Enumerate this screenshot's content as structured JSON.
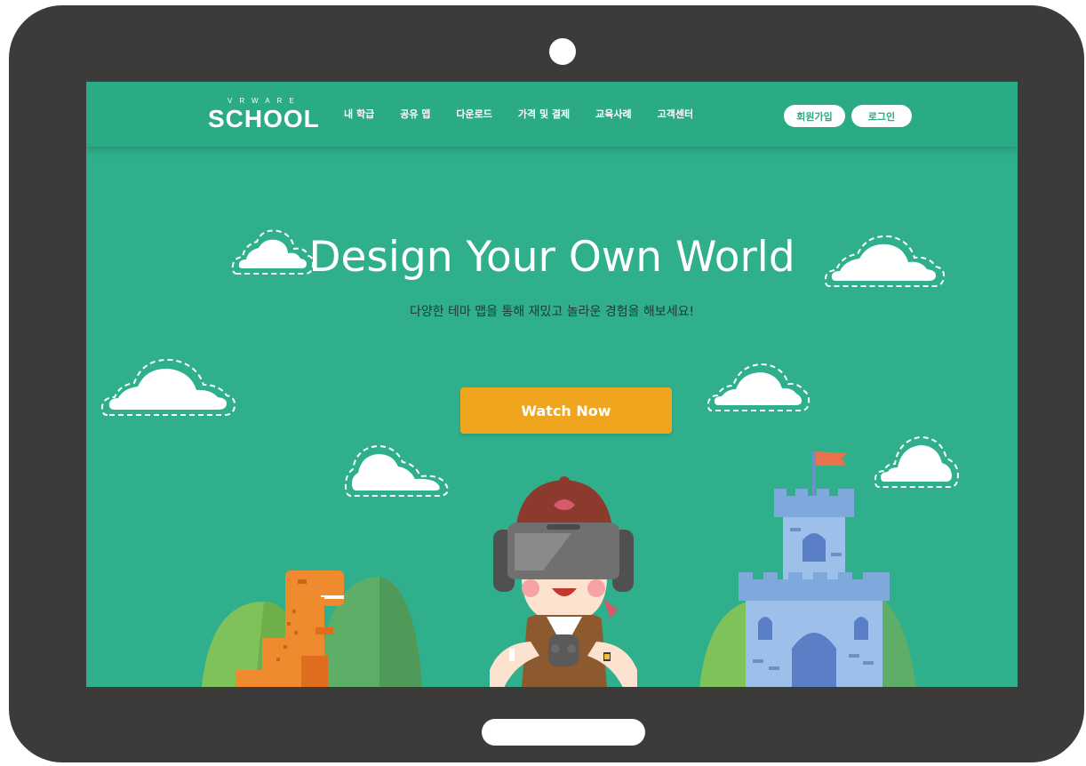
{
  "site": {
    "logo_small": "VRWARE",
    "logo_main": "SCHOOL"
  },
  "nav": {
    "items": [
      {
        "label": "내 학급"
      },
      {
        "label": "공유 맵"
      },
      {
        "label": "다운로드"
      },
      {
        "label": "가격 및 결제"
      },
      {
        "label": "교육사례"
      },
      {
        "label": "고객센터"
      }
    ],
    "signup_label": "회원가입",
    "login_label": "로그인"
  },
  "hero": {
    "title": "Design Your Own World",
    "subtitle": "다양한 테마 맵을 통해 재밌고 놀라운 경험을 해보세요!",
    "cta_label": "Watch Now"
  },
  "colors": {
    "background": "#2faf8b",
    "navbar": "#2baa86",
    "cta": "#f0a51e",
    "tablet_frame": "#3d3b39"
  },
  "icons": [
    "cloud-icon",
    "dinosaur-illustration",
    "vr-kid-illustration",
    "castle-illustration"
  ]
}
